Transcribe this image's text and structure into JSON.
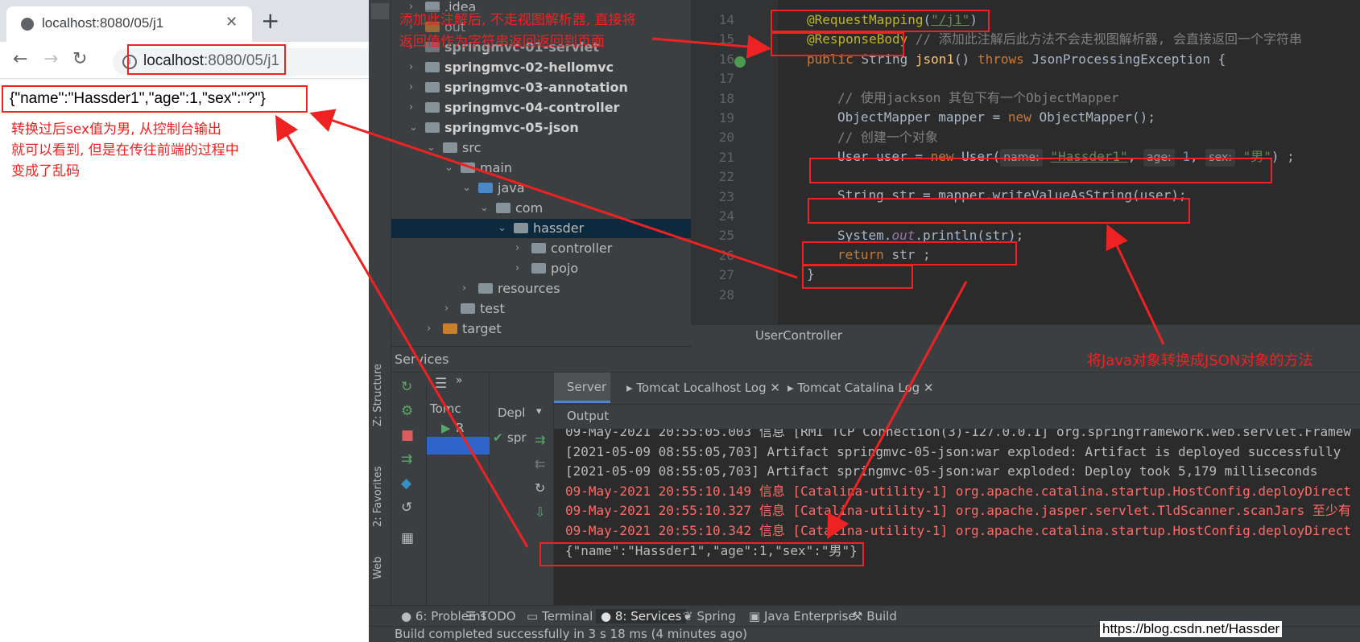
{
  "browser": {
    "tab_title": "localhost:8080/05/j1",
    "close_glyph": "✕",
    "new_tab_glyph": "+",
    "url_host": "localhost",
    "url_rest": ":8080/05/j1",
    "page_output": "{\"name\":\"Hassder1\",\"age\":1,\"sex\":\"?\"}",
    "icons": [
      "globe-icon",
      "back-icon",
      "forward-icon",
      "reload-icon",
      "info-icon"
    ]
  },
  "annotations": {
    "browser_note": [
      "转换过后sex值为男, 从控制台输出",
      "就可以看到, 但是在传往前端的过程中",
      "变成了乱码"
    ],
    "top_note": [
      "添加此注解后, 不走视图解析器, 直接将",
      "返回值作为字符串返回返回到页面"
    ],
    "bottom_note": "将Java对象转换成JSON对象的方法"
  },
  "project_tree": [
    {
      "label": ".idea",
      "indent": 0,
      "bold": false,
      "chev": ">"
    },
    {
      "label": "out",
      "indent": 0,
      "bold": false,
      "chev": ">",
      "orange": true
    },
    {
      "label": "springmvc-01-servlet",
      "indent": 0,
      "bold": true,
      "chev": ">"
    },
    {
      "label": "springmvc-02-hellomvc",
      "indent": 0,
      "bold": true,
      "chev": ">"
    },
    {
      "label": "springmvc-03-annotation",
      "indent": 0,
      "bold": true,
      "chev": ">"
    },
    {
      "label": "springmvc-04-controller",
      "indent": 0,
      "bold": true,
      "chev": ">"
    },
    {
      "label": "springmvc-05-json",
      "indent": 0,
      "bold": true,
      "chev": "v"
    },
    {
      "label": "src",
      "indent": 1,
      "bold": false,
      "chev": "v"
    },
    {
      "label": "main",
      "indent": 2,
      "bold": false,
      "chev": "v"
    },
    {
      "label": "java",
      "indent": 3,
      "bold": false,
      "chev": "v",
      "blue": true
    },
    {
      "label": "com",
      "indent": 4,
      "bold": false,
      "chev": "v"
    },
    {
      "label": "hassder",
      "indent": 5,
      "bold": false,
      "chev": "v",
      "selected": true
    },
    {
      "label": "controller",
      "indent": 6,
      "bold": false,
      "chev": ">"
    },
    {
      "label": "pojo",
      "indent": 6,
      "bold": false,
      "chev": ">"
    },
    {
      "label": "resources",
      "indent": 3,
      "bold": false,
      "chev": ">"
    },
    {
      "label": "test",
      "indent": 2,
      "bold": false,
      "chev": ">"
    },
    {
      "label": "target",
      "indent": 1,
      "bold": false,
      "chev": ">",
      "orange": true
    }
  ],
  "editor": {
    "line_numbers": [
      "14",
      "15",
      "16",
      "17",
      "18",
      "19",
      "20",
      "21",
      "22",
      "23",
      "24",
      "25",
      "26",
      "27",
      "28"
    ],
    "l14_ann": "@RequestMapping",
    "l14_open": "(",
    "l14_str": "\"/j1\"",
    "l14_close": ")",
    "l15_ann": "@ResponseBody",
    "l15_comment": " // 添加此注解后此方法不会走视图解析器, 会直接返回一个字符串",
    "l16_kw1": "public ",
    "l16_type": "String ",
    "l16_name": "json1",
    "l16_paren": "() ",
    "l16_kw2": "throws ",
    "l16_exc": "JsonProcessingException {",
    "l18_comment": "// 使用jackson 其包下有一个ObjectMapper",
    "l19_a": "ObjectMapper mapper = ",
    "l19_kw": "new ",
    "l19_b": "ObjectMapper();",
    "l20_comment": "// 创建一个对象",
    "l21_a": "User user = ",
    "l21_kw": "new ",
    "l21_b": "User(",
    "l21_h1": "name:",
    "l21_s1": "\"Hassder1\"",
    "l21_c1": ", ",
    "l21_h2": "age:",
    "l21_n": "1",
    "l21_c2": ", ",
    "l21_h3": "sex:",
    "l21_s3": "\"男\"",
    "l21_end": ") ;",
    "l23": "String str = mapper.writeValueAsString(user);",
    "l25_a": "System.",
    "l25_out": "out",
    "l25_b": ".println(str);",
    "l26_kw": "return ",
    "l26_b": "str ;",
    "l27": "}",
    "tab_label": "UserController"
  },
  "services": {
    "title": "Services",
    "tree_item": "Tomc",
    "tree_sub": "R",
    "deploy_label": "Depl",
    "deploy_item": "spr",
    "log_tabs": [
      "Server",
      "Tomcat Localhost Log",
      "Tomcat Catalina Log"
    ],
    "output_label": "Output",
    "log_lines": [
      {
        "text": "09-May-2021 20:55:05.003 信息 [RMI TCP Connection(3)-127.0.0.1] org.springframework.web.servlet.Framew",
        "red": false
      },
      {
        "text": "[2021-05-09 08:55:05,703] Artifact springmvc-05-json:war exploded: Artifact is deployed successfully",
        "red": false
      },
      {
        "text": "[2021-05-09 08:55:05,703] Artifact springmvc-05-json:war exploded: Deploy took 5,179 milliseconds",
        "red": false
      },
      {
        "text": "09-May-2021 20:55:10.149 信息 [Catalina-utility-1] org.apache.catalina.startup.HostConfig.deployDirect",
        "red": true
      },
      {
        "text": "09-May-2021 20:55:10.327 信息 [Catalina-utility-1] org.apache.jasper.servlet.TldScanner.scanJars 至少有",
        "red": true
      },
      {
        "text": "09-May-2021 20:55:10.342 信息 [Catalina-utility-1] org.apache.catalina.startup.HostConfig.deployDirect",
        "red": true
      },
      {
        "text": "{\"name\":\"Hassder1\",\"age\":1,\"sex\":\"男\"}",
        "red": false
      }
    ]
  },
  "side_tabs": [
    "Z: Structure",
    "2: Favorites",
    "Web"
  ],
  "bottom_tabs": [
    "6: Problems",
    "TODO",
    "Terminal",
    "8: Services",
    "Spring",
    "Java Enterprise",
    "Build"
  ],
  "status": "Build completed successfully in 3 s 18 ms (4 minutes ago)",
  "watermark": "https://blog.csdn.net/Hassder",
  "colors": {
    "annotation_red": "#ee2222",
    "ide_bg": "#2b2b2b",
    "panel_bg": "#3c3f41"
  }
}
